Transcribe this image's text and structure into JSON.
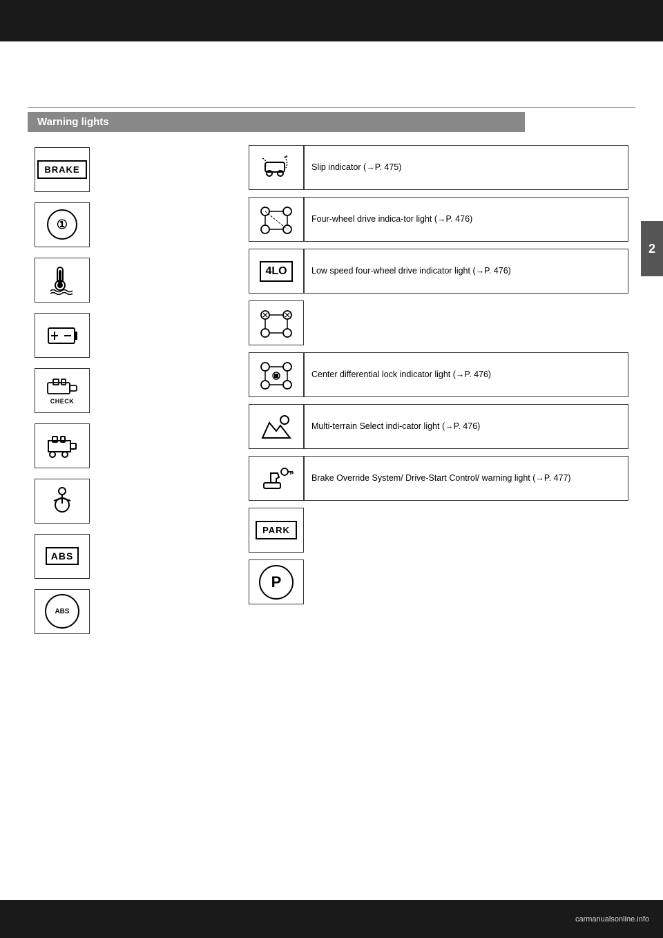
{
  "page": {
    "title": "Warning lights",
    "section_number": "2"
  },
  "header": {
    "rule_visible": true
  },
  "warning_lights": {
    "title": "Warning lights",
    "left_column": [
      {
        "id": "brake",
        "icon_type": "brake-text",
        "label": "BRAKE"
      },
      {
        "id": "charge",
        "icon_type": "circle-i",
        "label": "①"
      },
      {
        "id": "coolant",
        "icon_type": "svg-coolant",
        "label": "coolant"
      },
      {
        "id": "battery",
        "icon_type": "svg-battery",
        "label": "battery"
      },
      {
        "id": "check-engine",
        "icon_type": "check-engine",
        "label": "CHECK"
      },
      {
        "id": "malfunction",
        "icon_type": "svg-engine",
        "label": "engine"
      },
      {
        "id": "srs",
        "icon_type": "svg-srs",
        "label": "srs"
      },
      {
        "id": "abs-text",
        "icon_type": "abs-text",
        "label": "ABS"
      },
      {
        "id": "abs-circle",
        "icon_type": "abs-circle",
        "label": "ABS"
      }
    ],
    "right_column": [
      {
        "id": "slip",
        "icon_type": "svg-slip",
        "has_text": true,
        "text": "Slip indicator (→P. 475)"
      },
      {
        "id": "4wd",
        "icon_type": "svg-4wd",
        "has_text": true,
        "text": "Four-wheel drive indica-tor light (→P. 476)"
      },
      {
        "id": "4lo",
        "icon_type": "4lo-text",
        "has_text": true,
        "text": "Low speed four-wheel drive indicator light (→P. 476)"
      },
      {
        "id": "trac",
        "icon_type": "svg-trac",
        "has_text": false,
        "text": ""
      },
      {
        "id": "diff-lock",
        "icon_type": "svg-diff",
        "has_text": true,
        "text": "Center differential lock indicator light (→P. 476)"
      },
      {
        "id": "multi-terrain",
        "icon_type": "svg-terrain",
        "has_text": true,
        "text": "Multi-terrain Select indi-cator light (→P. 476)"
      },
      {
        "id": "brake-override",
        "icon_type": "svg-brake-override",
        "has_text": true,
        "text": "Brake Override System/ Drive-Start Control/ warning light (→P. 477)"
      },
      {
        "id": "park-text",
        "icon_type": "park-text",
        "has_text": false,
        "text": ""
      },
      {
        "id": "park-circle",
        "icon_type": "park-circle",
        "has_text": false,
        "text": ""
      }
    ]
  },
  "footer": {
    "website": "carmanualsonline.info"
  }
}
